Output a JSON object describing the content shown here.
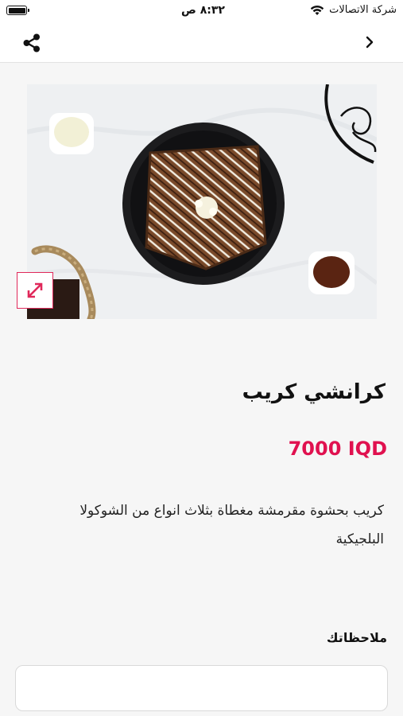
{
  "status_bar": {
    "carrier": "شركة الاتصالات",
    "time": "٨:٣٢ ص"
  },
  "nav": {
    "share_icon": "share-icon",
    "back_icon": "chevron-right-icon"
  },
  "product": {
    "image_alt": "crunchy crepe",
    "expand_icon": "expand-icon",
    "title": "كرانشي كريب",
    "price": "7000 IQD",
    "description": "كريب بحشوة مقرمشة مغطاة بثلاث انواع من الشوكولا البلجيكية"
  },
  "notes": {
    "label": "ملاحظاتك",
    "placeholder": "",
    "value": ""
  },
  "colors": {
    "accent": "#e0114f",
    "background": "#f6f6f6"
  }
}
